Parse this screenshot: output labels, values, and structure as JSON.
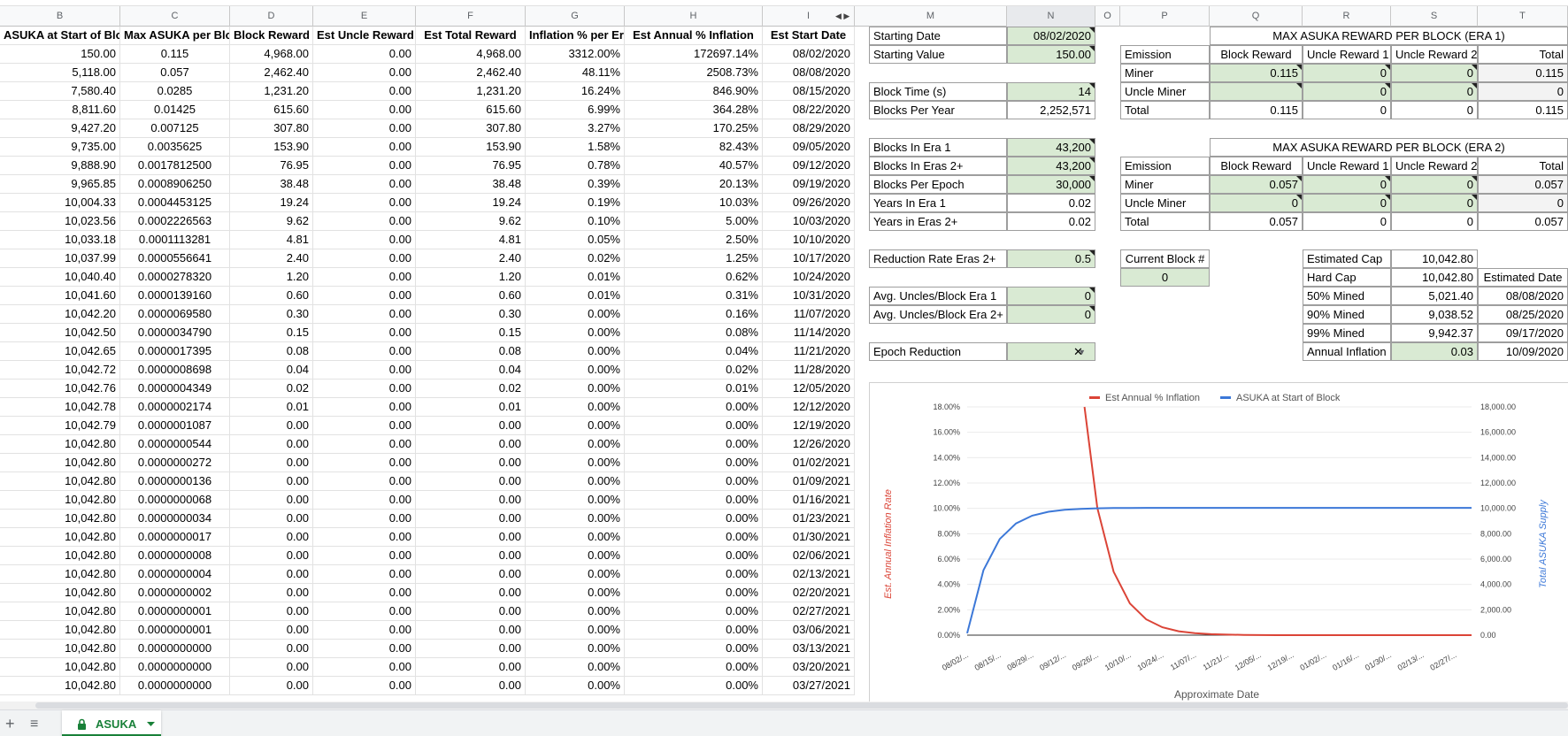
{
  "column_headers": [
    "B",
    "C",
    "D",
    "E",
    "F",
    "G",
    "H",
    "I",
    "M",
    "N",
    "O",
    "P",
    "Q",
    "R",
    "S",
    "T"
  ],
  "main_table": {
    "headers": [
      "ASUKA at Start of Block",
      "Max ASUKA per Block",
      "Block Reward",
      "Est Uncle Reward",
      "Est Total Reward",
      "Inflation % per Era",
      "Est Annual % Inflation",
      "Est Start Date"
    ],
    "rows": [
      [
        "150.00",
        "0.115",
        "4,968.00",
        "0.00",
        "4,968.00",
        "3312.00%",
        "172697.14%",
        "08/02/2020"
      ],
      [
        "5,118.00",
        "0.057",
        "2,462.40",
        "0.00",
        "2,462.40",
        "48.11%",
        "2508.73%",
        "08/08/2020"
      ],
      [
        "7,580.40",
        "0.0285",
        "1,231.20",
        "0.00",
        "1,231.20",
        "16.24%",
        "846.90%",
        "08/15/2020"
      ],
      [
        "8,811.60",
        "0.01425",
        "615.60",
        "0.00",
        "615.60",
        "6.99%",
        "364.28%",
        "08/22/2020"
      ],
      [
        "9,427.20",
        "0.007125",
        "307.80",
        "0.00",
        "307.80",
        "3.27%",
        "170.25%",
        "08/29/2020"
      ],
      [
        "9,735.00",
        "0.0035625",
        "153.90",
        "0.00",
        "153.90",
        "1.58%",
        "82.43%",
        "09/05/2020"
      ],
      [
        "9,888.90",
        "0.0017812500",
        "76.95",
        "0.00",
        "76.95",
        "0.78%",
        "40.57%",
        "09/12/2020"
      ],
      [
        "9,965.85",
        "0.0008906250",
        "38.48",
        "0.00",
        "38.48",
        "0.39%",
        "20.13%",
        "09/19/2020"
      ],
      [
        "10,004.33",
        "0.0004453125",
        "19.24",
        "0.00",
        "19.24",
        "0.19%",
        "10.03%",
        "09/26/2020"
      ],
      [
        "10,023.56",
        "0.0002226563",
        "9.62",
        "0.00",
        "9.62",
        "0.10%",
        "5.00%",
        "10/03/2020"
      ],
      [
        "10,033.18",
        "0.0001113281",
        "4.81",
        "0.00",
        "4.81",
        "0.05%",
        "2.50%",
        "10/10/2020"
      ],
      [
        "10,037.99",
        "0.0000556641",
        "2.40",
        "0.00",
        "2.40",
        "0.02%",
        "1.25%",
        "10/17/2020"
      ],
      [
        "10,040.40",
        "0.0000278320",
        "1.20",
        "0.00",
        "1.20",
        "0.01%",
        "0.62%",
        "10/24/2020"
      ],
      [
        "10,041.60",
        "0.0000139160",
        "0.60",
        "0.00",
        "0.60",
        "0.01%",
        "0.31%",
        "10/31/2020"
      ],
      [
        "10,042.20",
        "0.0000069580",
        "0.30",
        "0.00",
        "0.30",
        "0.00%",
        "0.16%",
        "11/07/2020"
      ],
      [
        "10,042.50",
        "0.0000034790",
        "0.15",
        "0.00",
        "0.15",
        "0.00%",
        "0.08%",
        "11/14/2020"
      ],
      [
        "10,042.65",
        "0.0000017395",
        "0.08",
        "0.00",
        "0.08",
        "0.00%",
        "0.04%",
        "11/21/2020"
      ],
      [
        "10,042.72",
        "0.0000008698",
        "0.04",
        "0.00",
        "0.04",
        "0.00%",
        "0.02%",
        "11/28/2020"
      ],
      [
        "10,042.76",
        "0.0000004349",
        "0.02",
        "0.00",
        "0.02",
        "0.00%",
        "0.01%",
        "12/05/2020"
      ],
      [
        "10,042.78",
        "0.0000002174",
        "0.01",
        "0.00",
        "0.01",
        "0.00%",
        "0.00%",
        "12/12/2020"
      ],
      [
        "10,042.79",
        "0.0000001087",
        "0.00",
        "0.00",
        "0.00",
        "0.00%",
        "0.00%",
        "12/19/2020"
      ],
      [
        "10,042.80",
        "0.0000000544",
        "0.00",
        "0.00",
        "0.00",
        "0.00%",
        "0.00%",
        "12/26/2020"
      ],
      [
        "10,042.80",
        "0.0000000272",
        "0.00",
        "0.00",
        "0.00",
        "0.00%",
        "0.00%",
        "01/02/2021"
      ],
      [
        "10,042.80",
        "0.0000000136",
        "0.00",
        "0.00",
        "0.00",
        "0.00%",
        "0.00%",
        "01/09/2021"
      ],
      [
        "10,042.80",
        "0.0000000068",
        "0.00",
        "0.00",
        "0.00",
        "0.00%",
        "0.00%",
        "01/16/2021"
      ],
      [
        "10,042.80",
        "0.0000000034",
        "0.00",
        "0.00",
        "0.00",
        "0.00%",
        "0.00%",
        "01/23/2021"
      ],
      [
        "10,042.80",
        "0.0000000017",
        "0.00",
        "0.00",
        "0.00",
        "0.00%",
        "0.00%",
        "01/30/2021"
      ],
      [
        "10,042.80",
        "0.0000000008",
        "0.00",
        "0.00",
        "0.00",
        "0.00%",
        "0.00%",
        "02/06/2021"
      ],
      [
        "10,042.80",
        "0.0000000004",
        "0.00",
        "0.00",
        "0.00",
        "0.00%",
        "0.00%",
        "02/13/2021"
      ],
      [
        "10,042.80",
        "0.0000000002",
        "0.00",
        "0.00",
        "0.00",
        "0.00%",
        "0.00%",
        "02/20/2021"
      ],
      [
        "10,042.80",
        "0.0000000001",
        "0.00",
        "0.00",
        "0.00",
        "0.00%",
        "0.00%",
        "02/27/2021"
      ],
      [
        "10,042.80",
        "0.0000000001",
        "0.00",
        "0.00",
        "0.00",
        "0.00%",
        "0.00%",
        "03/06/2021"
      ],
      [
        "10,042.80",
        "0.0000000000",
        "0.00",
        "0.00",
        "0.00",
        "0.00%",
        "0.00%",
        "03/13/2021"
      ],
      [
        "10,042.80",
        "0.0000000000",
        "0.00",
        "0.00",
        "0.00",
        "0.00%",
        "0.00%",
        "03/20/2021"
      ],
      [
        "10,042.80",
        "0.0000000000",
        "0.00",
        "0.00",
        "0.00",
        "0.00%",
        "0.00%",
        "03/27/2021"
      ]
    ]
  },
  "params": {
    "starting_date_label": "Starting Date",
    "starting_date": "08/02/2020",
    "starting_value_label": "Starting Value",
    "starting_value": "150.00",
    "block_time_label": "Block Time (s)",
    "block_time": "14",
    "blocks_per_year_label": "Blocks Per Year",
    "blocks_per_year": "2,252,571",
    "blocks_era1_label": "Blocks In Era 1",
    "blocks_era1": "43,200",
    "blocks_eras2_label": "Blocks In Eras 2+",
    "blocks_eras2": "43,200",
    "blocks_epoch_label": "Blocks Per Epoch",
    "blocks_epoch": "30,000",
    "years_era1_label": "Years In Era 1",
    "years_era1": "0.02",
    "years_eras2_label": "Years in Eras 2+",
    "years_eras2": "0.02",
    "reduction_label": "Reduction Rate Eras 2+",
    "reduction": "0.5",
    "uncles_era1_label": "Avg. Uncles/Block Era 1",
    "uncles_era1": "0",
    "uncles_eras2_label": "Avg. Uncles/Block Era 2+",
    "uncles_eras2": "0",
    "epoch_reduction_label": "Epoch Reduction",
    "epoch_reduction": "✕"
  },
  "era1": {
    "title": "MAX ASUKA REWARD PER BLOCK (ERA 1)",
    "headers": [
      "Emission",
      "Block Reward",
      "Uncle Reward 1",
      "Uncle Reward 2",
      "Total"
    ],
    "rows": [
      [
        "Miner",
        "0.115",
        "0",
        "0",
        "0.115"
      ],
      [
        "Uncle Miner",
        "",
        "0",
        "0",
        "0"
      ],
      [
        "Total",
        "0.115",
        "0",
        "0",
        "0.115"
      ]
    ]
  },
  "era2": {
    "title": "MAX ASUKA REWARD PER BLOCK (ERA 2)",
    "headers": [
      "Emission",
      "Block Reward",
      "Uncle Reward 1",
      "Uncle Reward 2",
      "Total"
    ],
    "rows": [
      [
        "Miner",
        "0.057",
        "0",
        "0",
        "0.057"
      ],
      [
        "Uncle Miner",
        "0",
        "0",
        "0",
        "0"
      ],
      [
        "Total",
        "0.057",
        "0",
        "0",
        "0.057"
      ]
    ]
  },
  "current_block": {
    "label": "Current Block #",
    "value": "0"
  },
  "caps": {
    "est_cap_label": "Estimated Cap",
    "est_cap": "10,042.80",
    "hard_cap_label": "Hard Cap",
    "hard_cap": "10,042.80",
    "est_date_header": "Estimated Date",
    "rows": [
      [
        "50% Mined",
        "5,021.40",
        "08/08/2020"
      ],
      [
        "90% Mined",
        "9,038.52",
        "08/25/2020"
      ],
      [
        "99% Mined",
        "9,942.37",
        "09/17/2020"
      ]
    ],
    "annual_inflation_label": "Annual Inflation",
    "annual_inflation": "0.03",
    "annual_inflation_date": "10/09/2020"
  },
  "chart_data": {
    "type": "line",
    "xlabel": "Approximate Date",
    "ylabel_left": "Est. Annual Inflation Rate",
    "ylabel_right": "Total ASUKA Supply",
    "legend_position": "top",
    "x_tick_labels": [
      "08/02/...",
      "08/15/...",
      "08/29/...",
      "09/12/...",
      "09/26/...",
      "10/10/...",
      "10/24/...",
      "11/07/...",
      "11/21/...",
      "12/05/...",
      "12/19/...",
      "01/02/...",
      "01/16/...",
      "01/30/...",
      "02/13/...",
      "02/27/..."
    ],
    "y_left_ticks": [
      "0.00%",
      "2.00%",
      "4.00%",
      "6.00%",
      "8.00%",
      "10.00%",
      "12.00%",
      "14.00%",
      "16.00%",
      "18.00%"
    ],
    "y_right_ticks": [
      "0.00",
      "2,000.00",
      "4,000.00",
      "6,000.00",
      "8,000.00",
      "10,000.00",
      "12,000.00",
      "14,000.00",
      "16,000.00",
      "18,000.00"
    ],
    "ylim_left": [
      0,
      18
    ],
    "ylim_right": [
      0,
      18000
    ],
    "x": [
      "08/02/2020",
      "08/08/2020",
      "08/15/2020",
      "08/22/2020",
      "08/29/2020",
      "09/05/2020",
      "09/12/2020",
      "09/19/2020",
      "09/26/2020",
      "10/03/2020",
      "10/10/2020",
      "10/17/2020",
      "10/24/2020",
      "10/31/2020",
      "11/07/2020",
      "11/14/2020",
      "11/21/2020",
      "11/28/2020",
      "12/05/2020",
      "12/12/2020",
      "12/19/2020",
      "12/26/2020",
      "01/02/2021",
      "01/09/2021",
      "01/16/2021",
      "01/23/2021",
      "01/30/2021",
      "02/06/2021",
      "02/13/2021",
      "02/20/2021",
      "02/27/2021",
      "03/06/2021"
    ],
    "series": [
      {
        "name": "Est Annual % Inflation",
        "axis": "left",
        "color": "#db4437",
        "values": [
          172697.14,
          2508.73,
          846.9,
          364.28,
          170.25,
          82.43,
          40.57,
          20.13,
          10.03,
          5.0,
          2.5,
          1.25,
          0.62,
          0.31,
          0.16,
          0.08,
          0.04,
          0.02,
          0.01,
          0,
          0,
          0,
          0,
          0,
          0,
          0,
          0,
          0,
          0,
          0,
          0,
          0
        ]
      },
      {
        "name": "ASUKA at Start of Block",
        "axis": "right",
        "color": "#3c78d8",
        "values": [
          150,
          5118,
          7580.4,
          8811.6,
          9427.2,
          9735,
          9888.9,
          9965.85,
          10004.33,
          10023.56,
          10033.18,
          10037.99,
          10040.4,
          10041.6,
          10042.2,
          10042.5,
          10042.65,
          10042.72,
          10042.76,
          10042.78,
          10042.79,
          10042.8,
          10042.8,
          10042.8,
          10042.8,
          10042.8,
          10042.8,
          10042.8,
          10042.8,
          10042.8,
          10042.8,
          10042.8
        ]
      }
    ]
  },
  "sheet_tab": {
    "name": "ASUKA"
  },
  "colors": {
    "input_green": "#d9ead3",
    "tab_green": "#188038",
    "inflation_red": "#db4437",
    "supply_blue": "#3c78d8"
  }
}
